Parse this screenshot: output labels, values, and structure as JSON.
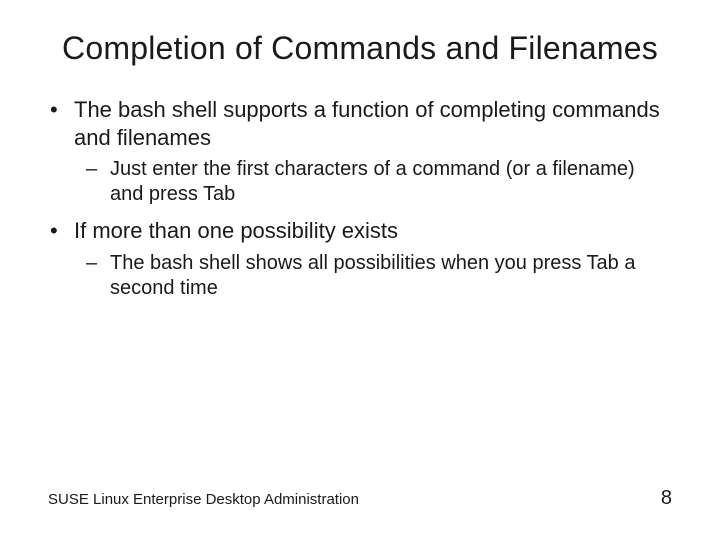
{
  "title": "Completion of Commands and Filenames",
  "bullets": [
    {
      "text": "The bash shell supports a function of completing commands and filenames",
      "sub": [
        "Just enter the first characters of a command (or a filename) and press Tab"
      ]
    },
    {
      "text": "If more than one possibility exists",
      "sub": [
        "The bash shell shows all possibilities when you press Tab a second time"
      ]
    }
  ],
  "footer": {
    "source": "SUSE Linux Enterprise Desktop Administration",
    "page": "8"
  },
  "glyphs": {
    "bullet": "•",
    "dash": "–"
  }
}
